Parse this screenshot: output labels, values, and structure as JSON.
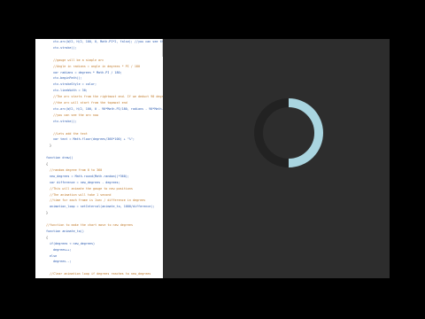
{
  "code_lines": [
    {
      "text": "ctx.arc(W/2, H/2, 100, 0, Math.PI*2, false); //you can see the arc now",
      "kind": "code",
      "indent": 2
    },
    {
      "text": "ctx.stroke();",
      "kind": "code",
      "indent": 2
    },
    {
      "text": "",
      "kind": "code",
      "indent": 0
    },
    {
      "text": "//gauge will be a simple arc",
      "kind": "comment",
      "indent": 2
    },
    {
      "text": "//Angle in radians = angle in degrees * PI / 180",
      "kind": "comment",
      "indent": 2
    },
    {
      "text": "var radians = degrees * Math.PI / 180;",
      "kind": "code",
      "indent": 2
    },
    {
      "text": "ctx.beginPath();",
      "kind": "code",
      "indent": 2
    },
    {
      "text": "ctx.strokeStyle = color;",
      "kind": "code",
      "indent": 2
    },
    {
      "text": "ctx.lineWidth = 30;",
      "kind": "code",
      "indent": 2
    },
    {
      "text": "//The arc starts from the rightmost end. If we deduct 90 degrees from the angles",
      "kind": "comment",
      "indent": 2
    },
    {
      "text": "//the arc will start from the topmost end",
      "kind": "comment",
      "indent": 2
    },
    {
      "text": "ctx.arc(W/2, H/2, 100, 0 - 90*Math.PI/180, radians - 90*Math.PI/180, false);",
      "kind": "code",
      "indent": 2
    },
    {
      "text": "//you can see the arc now",
      "kind": "comment",
      "indent": 2
    },
    {
      "text": "ctx.stroke();",
      "kind": "code",
      "indent": 2
    },
    {
      "text": "",
      "kind": "code",
      "indent": 0
    },
    {
      "text": "//Lets add the text",
      "kind": "comment",
      "indent": 2
    },
    {
      "text": "var text = Math.floor(degrees/360*100) + \"%\";",
      "kind": "code",
      "indent": 2
    },
    {
      "text": "}",
      "kind": "plain",
      "indent": 1
    },
    {
      "text": "",
      "kind": "code",
      "indent": 0
    },
    {
      "text": "function draw()",
      "kind": "keyword",
      "indent": 0
    },
    {
      "text": "{",
      "kind": "plain",
      "indent": 0
    },
    {
      "text": "//random degree from 0 to 360",
      "kind": "comment",
      "indent": 1
    },
    {
      "text": "new_degrees = Math.round(Math.random()*360);",
      "kind": "code",
      "indent": 1
    },
    {
      "text": "var difference = new_degrees - degrees;",
      "kind": "code",
      "indent": 1
    },
    {
      "text": "//This will animate the gauge to new positions",
      "kind": "comment",
      "indent": 1
    },
    {
      "text": "//The animation will take 1 second",
      "kind": "comment",
      "indent": 1
    },
    {
      "text": "//time for each frame is 1sec / difference in degrees",
      "kind": "comment",
      "indent": 1
    },
    {
      "text": "animation_loop = setInterval(animate_to, 1000/difference);",
      "kind": "code",
      "indent": 1
    },
    {
      "text": "}",
      "kind": "plain",
      "indent": 0
    },
    {
      "text": "",
      "kind": "code",
      "indent": 0
    },
    {
      "text": "//function to make the chart move to new degrees",
      "kind": "comment",
      "indent": 0
    },
    {
      "text": "function animate_to()",
      "kind": "keyword",
      "indent": 0
    },
    {
      "text": "{",
      "kind": "plain",
      "indent": 0
    },
    {
      "text": "if(degrees < new_degrees)",
      "kind": "code",
      "indent": 1
    },
    {
      "text": "degrees++;",
      "kind": "code",
      "indent": 2
    },
    {
      "text": "else",
      "kind": "keyword",
      "indent": 1
    },
    {
      "text": "degrees--;",
      "kind": "code",
      "indent": 2
    },
    {
      "text": "",
      "kind": "code",
      "indent": 0
    },
    {
      "text": "//Clear animation loop if degrees reaches to new_degrees",
      "kind": "comment",
      "indent": 1
    }
  ],
  "gauge": {
    "fraction": 0.5,
    "track_color": "#222222",
    "fill_color": "#a9d5e0"
  },
  "colors": {
    "background": "#000000",
    "stage": "#2d2d2d",
    "editor": "#ffffff"
  }
}
